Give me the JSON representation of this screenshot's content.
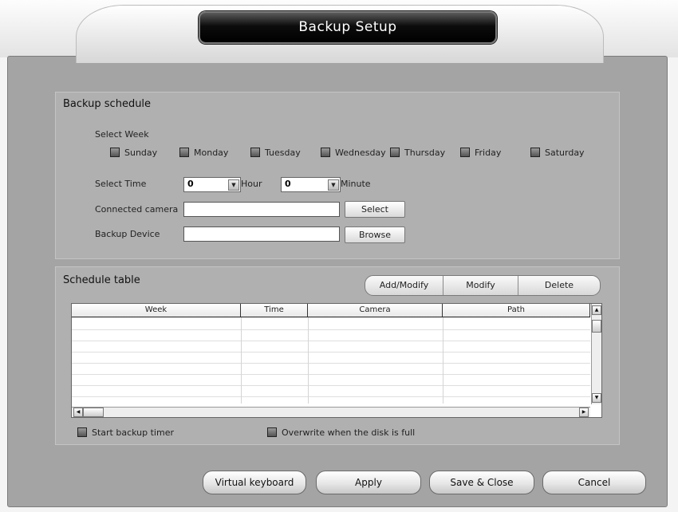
{
  "window": {
    "title": "Backup Setup"
  },
  "backup_schedule": {
    "title": "Backup schedule",
    "select_week_label": "Select Week",
    "days": [
      "Sunday",
      "Monday",
      "Tuesday",
      "Wednesday",
      "Thursday",
      "Friday",
      "Saturday"
    ],
    "select_time_label": "Select Time",
    "hour_value": "0",
    "hour_label": "Hour",
    "minute_value": "0",
    "minute_label": "Minute",
    "connected_camera_label": "Connected camera",
    "connected_camera_value": "",
    "select_button": "Select",
    "backup_device_label": "Backup Device",
    "backup_device_value": "",
    "browse_button": "Browse"
  },
  "schedule_table": {
    "title": "Schedule table",
    "add_modify_button": "Add/Modify",
    "modify_button": "Modify",
    "delete_button": "Delete",
    "columns": [
      "Week",
      "Time",
      "Camera",
      "Path"
    ],
    "rows": []
  },
  "options": {
    "start_backup_timer": "Start backup timer",
    "overwrite_full": "Overwrite when the disk is full"
  },
  "footer": {
    "virtual_keyboard": "Virtual keyboard",
    "apply": "Apply",
    "save_close": "Save & Close",
    "cancel": "Cancel"
  }
}
